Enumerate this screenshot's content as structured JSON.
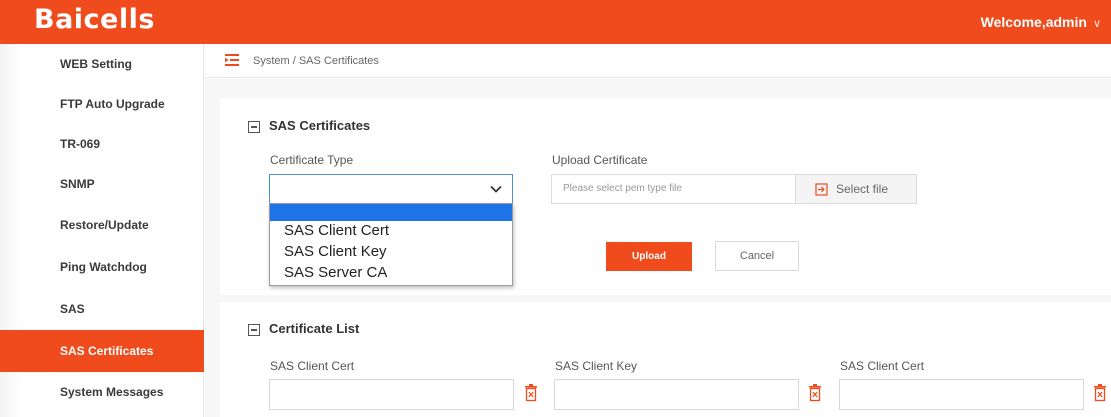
{
  "header": {
    "logo_text": "Baicells",
    "welcome_text": "Welcome,admin",
    "accent_color": "#f04b1c"
  },
  "sidebar": {
    "items": [
      {
        "label": "WEB Setting",
        "active": false
      },
      {
        "label": "FTP Auto Upgrade",
        "active": false
      },
      {
        "label": "TR-069",
        "active": false
      },
      {
        "label": "SNMP",
        "active": false
      },
      {
        "label": "Restore/Update",
        "active": false
      },
      {
        "label": "Ping Watchdog",
        "active": false
      },
      {
        "label": "SAS",
        "active": false
      },
      {
        "label": "SAS Certificates",
        "active": true
      },
      {
        "label": "System Messages",
        "active": false
      }
    ]
  },
  "breadcrumb": "System / SAS Certificates",
  "sas_certificates": {
    "title": "SAS Certificates",
    "certificate_type_label": "Certificate Type",
    "certificate_type_value": "",
    "dropdown_options": [
      "SAS Client Cert",
      "SAS Client Key",
      "SAS Server CA"
    ],
    "upload_certificate_label": "Upload Certificate",
    "file_placeholder": "Please select pem type file",
    "select_file_label": "Select file",
    "upload_button": "Upload",
    "cancel_button": "Cancel"
  },
  "certificate_list": {
    "title": "Certificate List",
    "columns": [
      {
        "label": "SAS Client Cert",
        "value": ""
      },
      {
        "label": "SAS Client Key",
        "value": ""
      },
      {
        "label": "SAS Client Cert",
        "value": ""
      }
    ]
  },
  "icons": {
    "menu": "menu-icon",
    "collapse": "collapse-icon",
    "chevron": "chevron-down-icon",
    "select_file": "file-import-icon",
    "delete": "trash-icon"
  }
}
